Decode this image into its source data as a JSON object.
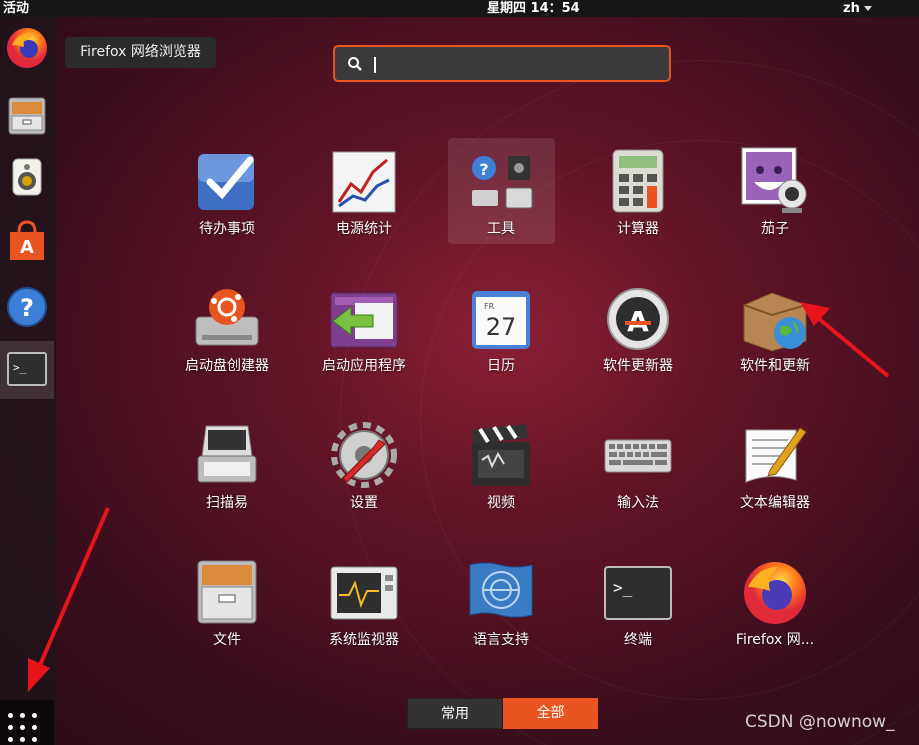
{
  "topbar": {
    "activities": "活动",
    "clock": "星期四 14：54",
    "lang": "zh"
  },
  "tooltip": "Firefox 网络浏览器",
  "search": {
    "value": ""
  },
  "dock": {
    "items": [
      {
        "icon": "firefox-icon"
      },
      {
        "icon": "file-cabinet-icon"
      },
      {
        "icon": "speaker-icon"
      },
      {
        "icon": "software-store-icon"
      },
      {
        "icon": "help-icon"
      },
      {
        "icon": "terminal-icon"
      }
    ],
    "show_apps_icon": "grid-icon"
  },
  "apps": [
    {
      "label": "待办事项",
      "icon": "todo-check-icon"
    },
    {
      "label": "电源统计",
      "icon": "power-stats-icon"
    },
    {
      "label": "工具",
      "icon": "tools-folder-icon"
    },
    {
      "label": "计算器",
      "icon": "calculator-icon"
    },
    {
      "label": "茄子",
      "icon": "cheese-webcam-icon"
    },
    {
      "label": "启动盘创建器",
      "icon": "usb-creator-icon"
    },
    {
      "label": "启动应用程序",
      "icon": "startup-apps-icon"
    },
    {
      "label": "日历",
      "icon": "calendar-icon",
      "day_label": "FR",
      "day": "27"
    },
    {
      "label": "软件更新器",
      "icon": "software-updater-icon"
    },
    {
      "label": "软件和更新",
      "icon": "software-sources-icon"
    },
    {
      "label": "扫描易",
      "icon": "scanner-icon"
    },
    {
      "label": "设置",
      "icon": "settings-gear-icon"
    },
    {
      "label": "视频",
      "icon": "video-clapper-icon"
    },
    {
      "label": "输入法",
      "icon": "keyboard-icon"
    },
    {
      "label": "文本编辑器",
      "icon": "text-editor-icon"
    },
    {
      "label": "文件",
      "icon": "files-icon"
    },
    {
      "label": "系统监视器",
      "icon": "system-monitor-icon"
    },
    {
      "label": "语言支持",
      "icon": "language-support-icon"
    },
    {
      "label": "终端",
      "icon": "terminal-icon"
    },
    {
      "label": "Firefox 网...",
      "icon": "firefox-icon"
    }
  ],
  "tabs": {
    "common": "常用",
    "all": "全部"
  },
  "watermark": "CSDN @nownow_",
  "colors": {
    "accent": "#e95420",
    "arrow": "#e8141c"
  }
}
